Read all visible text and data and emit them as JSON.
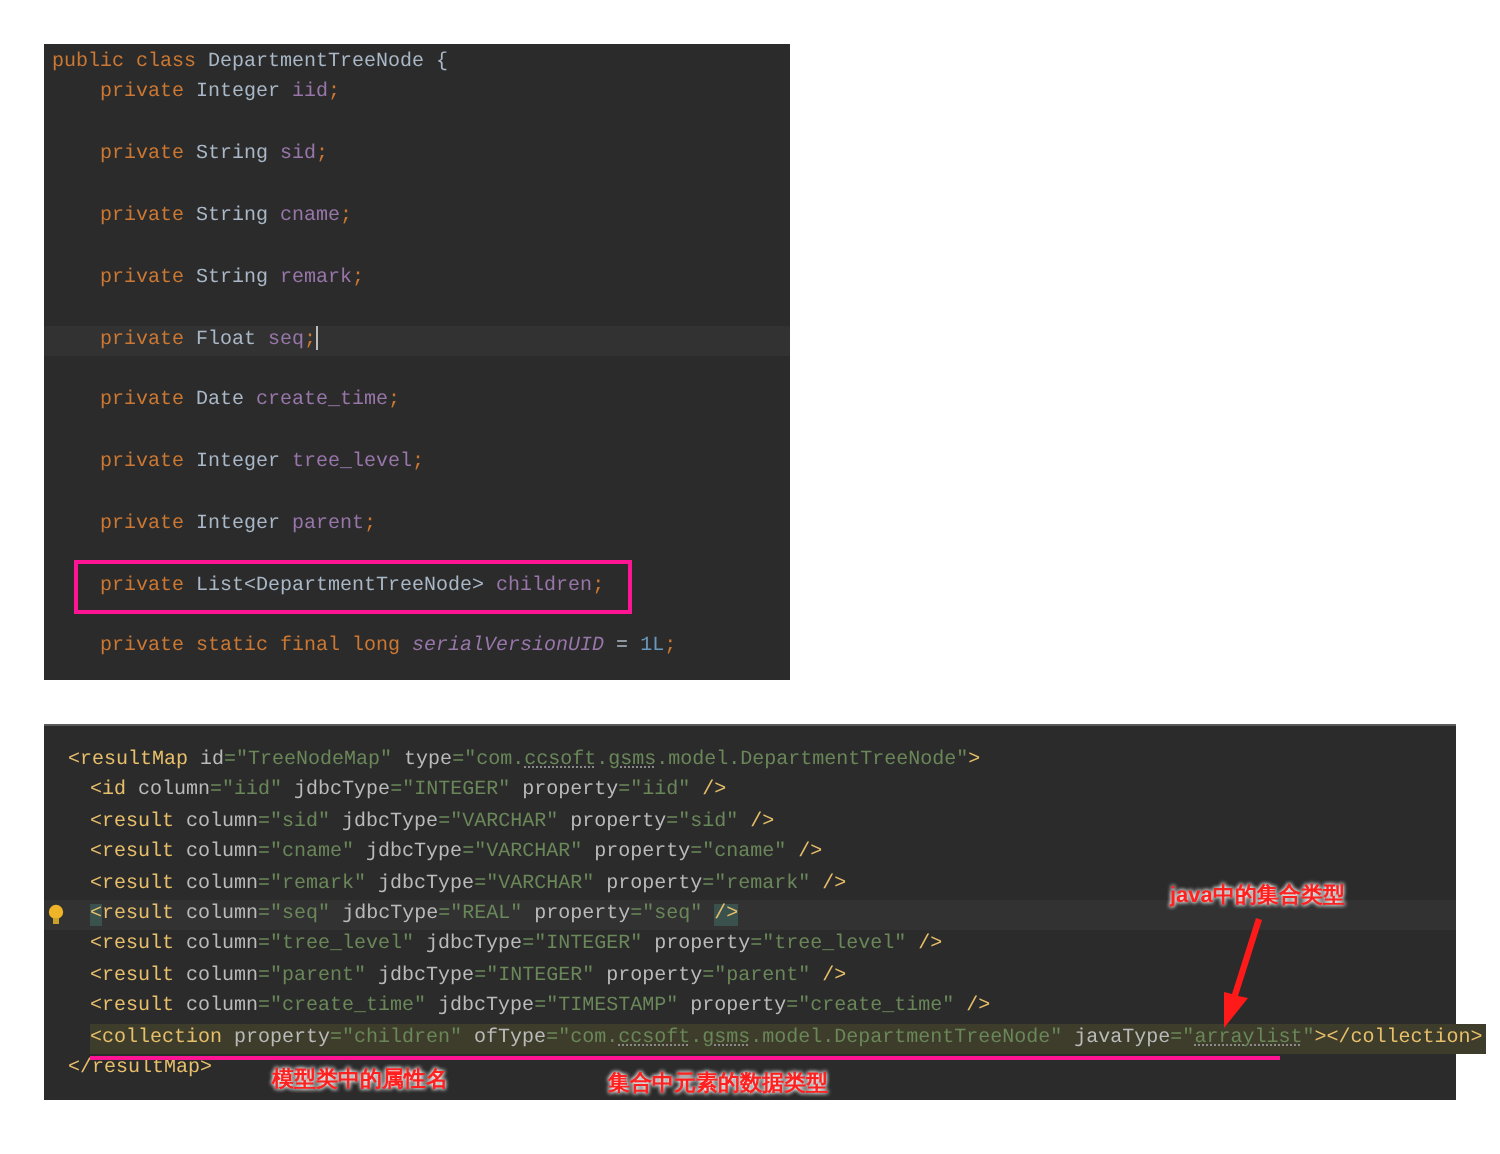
{
  "java_editor": {
    "lines": [
      {
        "kind": "top",
        "current": false,
        "boxed": false,
        "tokens": [
          {
            "kind": "keyword",
            "text": "public class "
          },
          {
            "kind": "plain",
            "text": "DepartmentTreeNode {"
          }
        ]
      },
      {
        "kind": "nested",
        "current": false,
        "boxed": false,
        "tokens": [
          {
            "kind": "keyword",
            "text": "private "
          },
          {
            "kind": "plain",
            "text": "Integer "
          },
          {
            "kind": "field",
            "text": "iid"
          },
          {
            "kind": "keyword",
            "text": ";"
          }
        ]
      },
      {
        "kind": "nested",
        "current": false,
        "boxed": false,
        "tokens": [
          {
            "kind": "keyword",
            "text": "private "
          },
          {
            "kind": "plain",
            "text": "String "
          },
          {
            "kind": "field",
            "text": "sid"
          },
          {
            "kind": "keyword",
            "text": ";"
          }
        ]
      },
      {
        "kind": "nested",
        "current": false,
        "boxed": false,
        "tokens": [
          {
            "kind": "keyword",
            "text": "private "
          },
          {
            "kind": "plain",
            "text": "String "
          },
          {
            "kind": "field",
            "text": "cname"
          },
          {
            "kind": "keyword",
            "text": ";"
          }
        ]
      },
      {
        "kind": "nested",
        "current": false,
        "boxed": false,
        "tokens": [
          {
            "kind": "keyword",
            "text": "private "
          },
          {
            "kind": "plain",
            "text": "String "
          },
          {
            "kind": "field",
            "text": "remark"
          },
          {
            "kind": "keyword",
            "text": ";"
          }
        ]
      },
      {
        "kind": "nested",
        "current": true,
        "boxed": false,
        "tokens": [
          {
            "kind": "keyword",
            "text": "private "
          },
          {
            "kind": "plain",
            "text": "Float "
          },
          {
            "kind": "field",
            "text": "seq"
          },
          {
            "kind": "keyword",
            "text": ";"
          }
        ]
      },
      {
        "kind": "nested",
        "current": false,
        "boxed": false,
        "tokens": [
          {
            "kind": "keyword",
            "text": "private "
          },
          {
            "kind": "plain",
            "text": "Date "
          },
          {
            "kind": "field",
            "text": "create_time"
          },
          {
            "kind": "keyword",
            "text": ";"
          }
        ]
      },
      {
        "kind": "nested",
        "current": false,
        "boxed": false,
        "tokens": [
          {
            "kind": "keyword",
            "text": "private "
          },
          {
            "kind": "plain",
            "text": "Integer "
          },
          {
            "kind": "field",
            "text": "tree_level"
          },
          {
            "kind": "keyword",
            "text": ";"
          }
        ]
      },
      {
        "kind": "nested",
        "current": false,
        "boxed": false,
        "tokens": [
          {
            "kind": "keyword",
            "text": "private "
          },
          {
            "kind": "plain",
            "text": "Integer "
          },
          {
            "kind": "field",
            "text": "parent"
          },
          {
            "kind": "keyword",
            "text": ";"
          }
        ]
      },
      {
        "kind": "nested",
        "current": false,
        "boxed": true,
        "tokens": [
          {
            "kind": "keyword",
            "text": "private "
          },
          {
            "kind": "plain",
            "text": "List<DepartmentTreeNode> "
          },
          {
            "kind": "field",
            "text": "children"
          },
          {
            "kind": "keyword",
            "text": ";"
          }
        ]
      },
      {
        "kind": "nested",
        "current": false,
        "boxed": false,
        "tokens": [
          {
            "kind": "keyword",
            "text": "private static final long "
          },
          {
            "kind": "static_field",
            "text": "serialVersionUID"
          },
          {
            "kind": "plain",
            "text": " = "
          },
          {
            "kind": "number",
            "text": "1L"
          },
          {
            "kind": "keyword",
            "text": ";"
          }
        ]
      }
    ]
  },
  "xml_editor": {
    "lines": [
      {
        "kind": "top",
        "current": false,
        "highlighted": false,
        "tokens": [
          {
            "kind": "tag",
            "text": "<resultMap"
          },
          {
            "kind": "attr",
            "text": " id"
          },
          {
            "kind": "value",
            "text": "=\"TreeNodeMap\""
          },
          {
            "kind": "attr",
            "text": " type"
          },
          {
            "kind": "value",
            "text": "=\"com."
          },
          {
            "kind": "typo",
            "text": "ccsoft"
          },
          {
            "kind": "value",
            "text": "."
          },
          {
            "kind": "typo",
            "text": "gsms"
          },
          {
            "kind": "value",
            "text": ".model.DepartmentTreeNode\""
          },
          {
            "kind": "tag",
            "text": ">"
          }
        ]
      },
      {
        "kind": "nested",
        "current": false,
        "highlighted": false,
        "tokens": [
          {
            "kind": "tag",
            "text": "<id"
          },
          {
            "kind": "attr",
            "text": " column"
          },
          {
            "kind": "value",
            "text": "=\"iid\""
          },
          {
            "kind": "attr",
            "text": " jdbcType"
          },
          {
            "kind": "value",
            "text": "=\"INTEGER\""
          },
          {
            "kind": "attr",
            "text": " property"
          },
          {
            "kind": "value",
            "text": "=\"iid\""
          },
          {
            "kind": "tag",
            "text": " />"
          }
        ]
      },
      {
        "kind": "nested",
        "current": false,
        "highlighted": false,
        "tokens": [
          {
            "kind": "tag",
            "text": "<result"
          },
          {
            "kind": "attr",
            "text": " column"
          },
          {
            "kind": "value",
            "text": "=\"sid\""
          },
          {
            "kind": "attr",
            "text": " jdbcType"
          },
          {
            "kind": "value",
            "text": "=\"VARCHAR\""
          },
          {
            "kind": "attr",
            "text": " property"
          },
          {
            "kind": "value",
            "text": "=\"sid\""
          },
          {
            "kind": "tag",
            "text": " />"
          }
        ]
      },
      {
        "kind": "nested",
        "current": false,
        "highlighted": false,
        "tokens": [
          {
            "kind": "tag",
            "text": "<result"
          },
          {
            "kind": "attr",
            "text": " column"
          },
          {
            "kind": "value",
            "text": "=\"cname\""
          },
          {
            "kind": "attr",
            "text": " jdbcType"
          },
          {
            "kind": "value",
            "text": "=\"VARCHAR\""
          },
          {
            "kind": "attr",
            "text": " property"
          },
          {
            "kind": "value",
            "text": "=\"cname\""
          },
          {
            "kind": "tag",
            "text": " />"
          }
        ]
      },
      {
        "kind": "nested",
        "current": false,
        "highlighted": false,
        "tokens": [
          {
            "kind": "tag",
            "text": "<result"
          },
          {
            "kind": "attr",
            "text": " column"
          },
          {
            "kind": "value",
            "text": "=\"remark\""
          },
          {
            "kind": "attr",
            "text": " jdbcType"
          },
          {
            "kind": "value",
            "text": "=\"VARCHAR\""
          },
          {
            "kind": "attr",
            "text": " property"
          },
          {
            "kind": "value",
            "text": "=\"remark\""
          },
          {
            "kind": "tag",
            "text": " />"
          }
        ]
      },
      {
        "kind": "nested",
        "current": true,
        "highlighted": false,
        "tokens": [
          {
            "kind": "tag_match",
            "text": "<"
          },
          {
            "kind": "tag",
            "text": "result"
          },
          {
            "kind": "attr",
            "text": " column"
          },
          {
            "kind": "value",
            "text": "=\"seq\""
          },
          {
            "kind": "attr",
            "text": " jdbcType"
          },
          {
            "kind": "value",
            "text": "=\"REAL\""
          },
          {
            "kind": "attr",
            "text": " property"
          },
          {
            "kind": "value",
            "text": "=\"seq\" "
          },
          {
            "kind": "tag_match",
            "text": "/>"
          }
        ]
      },
      {
        "kind": "nested",
        "current": false,
        "highlighted": false,
        "tokens": [
          {
            "kind": "tag",
            "text": "<result"
          },
          {
            "kind": "attr",
            "text": " column"
          },
          {
            "kind": "value",
            "text": "=\"tree_level\""
          },
          {
            "kind": "attr",
            "text": " jdbcType"
          },
          {
            "kind": "value",
            "text": "=\"INTEGER\""
          },
          {
            "kind": "attr",
            "text": " property"
          },
          {
            "kind": "value",
            "text": "=\"tree_level\""
          },
          {
            "kind": "tag",
            "text": " />"
          }
        ]
      },
      {
        "kind": "nested",
        "current": false,
        "highlighted": false,
        "tokens": [
          {
            "kind": "tag",
            "text": "<result"
          },
          {
            "kind": "attr",
            "text": " column"
          },
          {
            "kind": "value",
            "text": "=\"parent\""
          },
          {
            "kind": "attr",
            "text": " jdbcType"
          },
          {
            "kind": "value",
            "text": "=\"INTEGER\""
          },
          {
            "kind": "attr",
            "text": " property"
          },
          {
            "kind": "value",
            "text": "=\"parent\""
          },
          {
            "kind": "tag",
            "text": " />"
          }
        ]
      },
      {
        "kind": "nested",
        "current": false,
        "highlighted": false,
        "tokens": [
          {
            "kind": "tag",
            "text": "<result"
          },
          {
            "kind": "attr",
            "text": " column"
          },
          {
            "kind": "value",
            "text": "=\"create_time\""
          },
          {
            "kind": "attr",
            "text": " jdbcType"
          },
          {
            "kind": "value",
            "text": "=\"TIMESTAMP\""
          },
          {
            "kind": "attr",
            "text": " property"
          },
          {
            "kind": "value",
            "text": "=\"create_time\""
          },
          {
            "kind": "tag",
            "text": " />"
          }
        ]
      },
      {
        "kind": "nested",
        "current": false,
        "highlighted": true,
        "tokens": [
          {
            "kind": "tag",
            "text": "<collection"
          },
          {
            "kind": "attr",
            "text": " property"
          },
          {
            "kind": "value",
            "text": "=\"children\""
          },
          {
            "kind": "attr",
            "text": " ofType"
          },
          {
            "kind": "value",
            "text": "=\"com."
          },
          {
            "kind": "typo",
            "text": "ccsoft"
          },
          {
            "kind": "value",
            "text": "."
          },
          {
            "kind": "typo",
            "text": "gsms"
          },
          {
            "kind": "value",
            "text": ".model.DepartmentTreeNode\""
          },
          {
            "kind": "attr",
            "text": " javaType"
          },
          {
            "kind": "value",
            "text": "=\""
          },
          {
            "kind": "typo",
            "text": "arraylist"
          },
          {
            "kind": "value",
            "text": "\""
          },
          {
            "kind": "tag",
            "text": "></collection>"
          }
        ]
      },
      {
        "kind": "top",
        "current": false,
        "highlighted": false,
        "tokens": [
          {
            "kind": "tag",
            "text": "</resultMap>"
          }
        ]
      }
    ]
  },
  "annotations": [
    {
      "text": "java中的集合类型"
    },
    {
      "text": "模型类中的属性名"
    },
    {
      "text": "集合中元素的数据类型"
    }
  ]
}
